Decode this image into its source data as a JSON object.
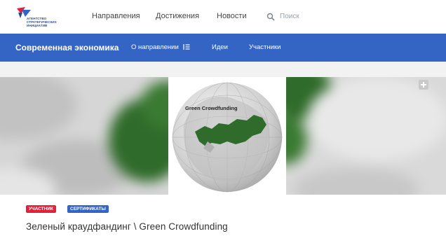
{
  "header": {
    "logo_text": "АГЕНТСТВО\nСТРАТЕГИЧЕСКИХ\nИНИЦИАТИВ",
    "nav": [
      {
        "label": "Направления"
      },
      {
        "label": "Достижения"
      },
      {
        "label": "Новости"
      }
    ],
    "search": {
      "placeholder": "Поиск",
      "icon": "search-icon"
    }
  },
  "section_bar": {
    "title": "Современная экономика",
    "about": "О направлении",
    "ideas": "Идеи",
    "members": "Участники",
    "color": "#3565c4"
  },
  "banner": {
    "map_label": "Green Crowdfunding",
    "add_icon": "plus-square-icon"
  },
  "tags": [
    {
      "label": "УЧАСТНИК",
      "color": "#e2213a"
    },
    {
      "label": "СЕРТИФИКАТЫ",
      "color": "#3565c4"
    }
  ],
  "project": {
    "title": "Зеленый краудфандинг \\ Green Crowdfunding"
  }
}
